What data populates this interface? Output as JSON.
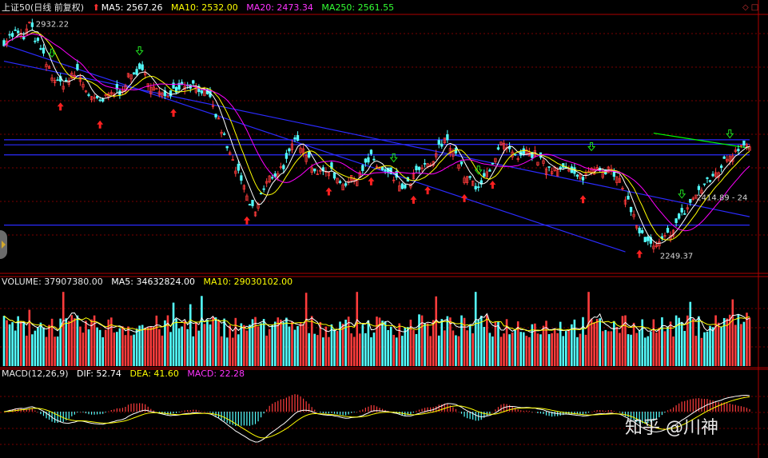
{
  "price_header": {
    "title": "上证50(日线 前复权)",
    "ma5_label": "MA5: 2567.26",
    "ma10_label": "MA10: 2532.00",
    "ma20_label": "MA20: 2473.34",
    "ma250_label": "MA250: 2561.55"
  },
  "volume_header": {
    "title": "VOLUME: 37907380.00",
    "ma5_label": "MA5: 34632824.00",
    "ma10_label": "MA10: 29030102.00"
  },
  "macd_header": {
    "title": "MACD(12,26,9)",
    "dif_label": "DIF: 52.74",
    "dea_label": "DEA: 41.60",
    "macd_label": "MACD: 22.28"
  },
  "annotations": {
    "high": "2932.22",
    "low": "2249.37",
    "last": "2414.89 - 24"
  },
  "watermark": "知乎 @川神",
  "colors": {
    "up": "#ff3c3c",
    "down": "#54ffff",
    "ma5": "#ffffff",
    "ma10": "#ffff00",
    "ma20": "#ff00ff",
    "ma250": "#00ff00",
    "grid": "#8b0000",
    "trendline": "#2b2bff",
    "background": "#000000"
  },
  "icons": {
    "buy_signal": "red-up-arrow-icon",
    "sell_signal": "green-down-arrow-icon",
    "window_controls": [
      "diamond-icon",
      "square-icon"
    ]
  },
  "chart_data": {
    "type": "candlestick",
    "title": "上证50(日线 前复权)",
    "ylim": [
      2200,
      2960
    ],
    "grid": true,
    "moving_averages": [
      "MA5",
      "MA10",
      "MA20",
      "MA250"
    ],
    "price_keypoints": [
      [
        0,
        2880
      ],
      [
        4,
        2905
      ],
      [
        7,
        2890
      ],
      [
        9,
        2932
      ],
      [
        12,
        2870
      ],
      [
        16,
        2795
      ],
      [
        19,
        2750
      ],
      [
        23,
        2765
      ],
      [
        26,
        2790
      ],
      [
        29,
        2735
      ],
      [
        32,
        2700
      ],
      [
        35,
        2700
      ],
      [
        38,
        2725
      ],
      [
        41,
        2730
      ],
      [
        44,
        2770
      ],
      [
        47,
        2790
      ],
      [
        50,
        2780
      ],
      [
        53,
        2740
      ],
      [
        56,
        2715
      ],
      [
        59,
        2730
      ],
      [
        62,
        2745
      ],
      [
        65,
        2755
      ],
      [
        68,
        2745
      ],
      [
        70,
        2735
      ],
      [
        73,
        2700
      ],
      [
        76,
        2640
      ],
      [
        80,
        2540
      ],
      [
        84,
        2460
      ],
      [
        87,
        2390
      ],
      [
        89,
        2370
      ],
      [
        91,
        2420
      ],
      [
        94,
        2470
      ],
      [
        97,
        2490
      ],
      [
        100,
        2520
      ],
      [
        103,
        2580
      ],
      [
        106,
        2570
      ],
      [
        109,
        2510
      ],
      [
        112,
        2480
      ],
      [
        115,
        2500
      ],
      [
        118,
        2470
      ],
      [
        121,
        2455
      ],
      [
        124,
        2470
      ],
      [
        127,
        2500
      ],
      [
        130,
        2530
      ],
      [
        133,
        2500
      ],
      [
        136,
        2480
      ],
      [
        139,
        2460
      ],
      [
        142,
        2435
      ],
      [
        145,
        2475
      ],
      [
        148,
        2500
      ],
      [
        151,
        2505
      ],
      [
        154,
        2560
      ],
      [
        157,
        2590
      ],
      [
        160,
        2540
      ],
      [
        163,
        2480
      ],
      [
        166,
        2455
      ],
      [
        168,
        2430
      ],
      [
        170,
        2470
      ],
      [
        173,
        2520
      ],
      [
        176,
        2570
      ],
      [
        179,
        2550
      ],
      [
        182,
        2520
      ],
      [
        185,
        2545
      ],
      [
        188,
        2540
      ],
      [
        191,
        2510
      ],
      [
        194,
        2500
      ],
      [
        197,
        2510
      ],
      [
        200,
        2490
      ],
      [
        203,
        2470
      ],
      [
        206,
        2480
      ],
      [
        209,
        2510
      ],
      [
        212,
        2500
      ],
      [
        215,
        2490
      ],
      [
        218,
        2455
      ],
      [
        221,
        2400
      ],
      [
        224,
        2330
      ],
      [
        227,
        2280
      ],
      [
        230,
        2262
      ],
      [
        232,
        2270
      ],
      [
        235,
        2300
      ],
      [
        238,
        2335
      ],
      [
        241,
        2370
      ],
      [
        244,
        2410
      ],
      [
        247,
        2440
      ],
      [
        250,
        2465
      ],
      [
        253,
        2495
      ],
      [
        256,
        2530
      ],
      [
        259,
        2555
      ],
      [
        262,
        2580
      ],
      [
        264,
        2575
      ]
    ],
    "volume_range": [
      0,
      60000000
    ],
    "volume_last": 37907380,
    "volume_ma5": 34632824,
    "volume_ma10": 29030102,
    "macd": {
      "dif": 52.74,
      "dea": 41.6,
      "macd": 22.28
    }
  }
}
